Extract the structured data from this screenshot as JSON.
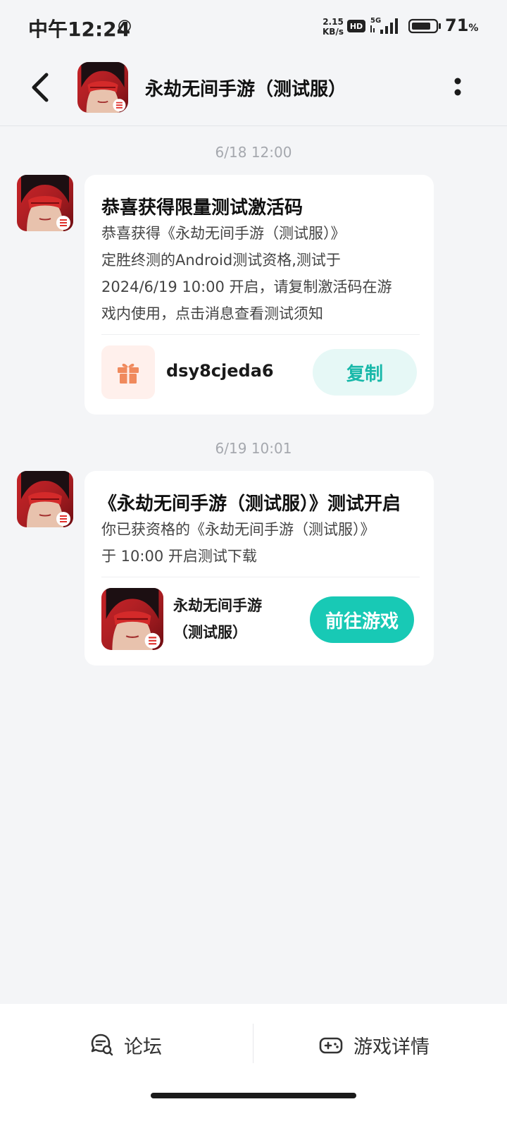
{
  "status_bar": {
    "time": "中午12:24",
    "net_speed_value": "2.15",
    "net_speed_unit": "KB/s",
    "hd_badge": "HD",
    "network": "5G",
    "battery_value": "71",
    "battery_unit": "%"
  },
  "header": {
    "title": "永劫无间手游（测试服）"
  },
  "messages": [
    {
      "timestamp": "6/18  12:00",
      "title": "恭喜获得限量测试激活码",
      "body_lines": [
        "恭喜获得《永劫无间手游（测试服）》",
        "定胜终测的Android测试资格,测试于",
        "2024/6/19 10:00 开启，请复制激活码在游",
        "戏内使用，点击消息查看测试须知"
      ],
      "code": "dsy8cjeda6",
      "copy_label": "复制"
    },
    {
      "timestamp": "6/19  10:01",
      "title": "《永劫无间手游（测试服）》测试开启",
      "body_lines": [
        "你已获资格的《永劫无间手游（测试服）》",
        "于 10:00 开启测试下载"
      ],
      "game_name_lines": [
        "永劫无间手游",
        "（测试服）"
      ],
      "play_label": "前往游戏"
    }
  ],
  "bottom_bar": {
    "forum_label": "论坛",
    "game_detail_label": "游戏详情"
  },
  "colors": {
    "accent": "#18c9b5",
    "accent_light": "#e6f8f6",
    "gift": "#f08a5d",
    "background": "#f4f5f7"
  }
}
